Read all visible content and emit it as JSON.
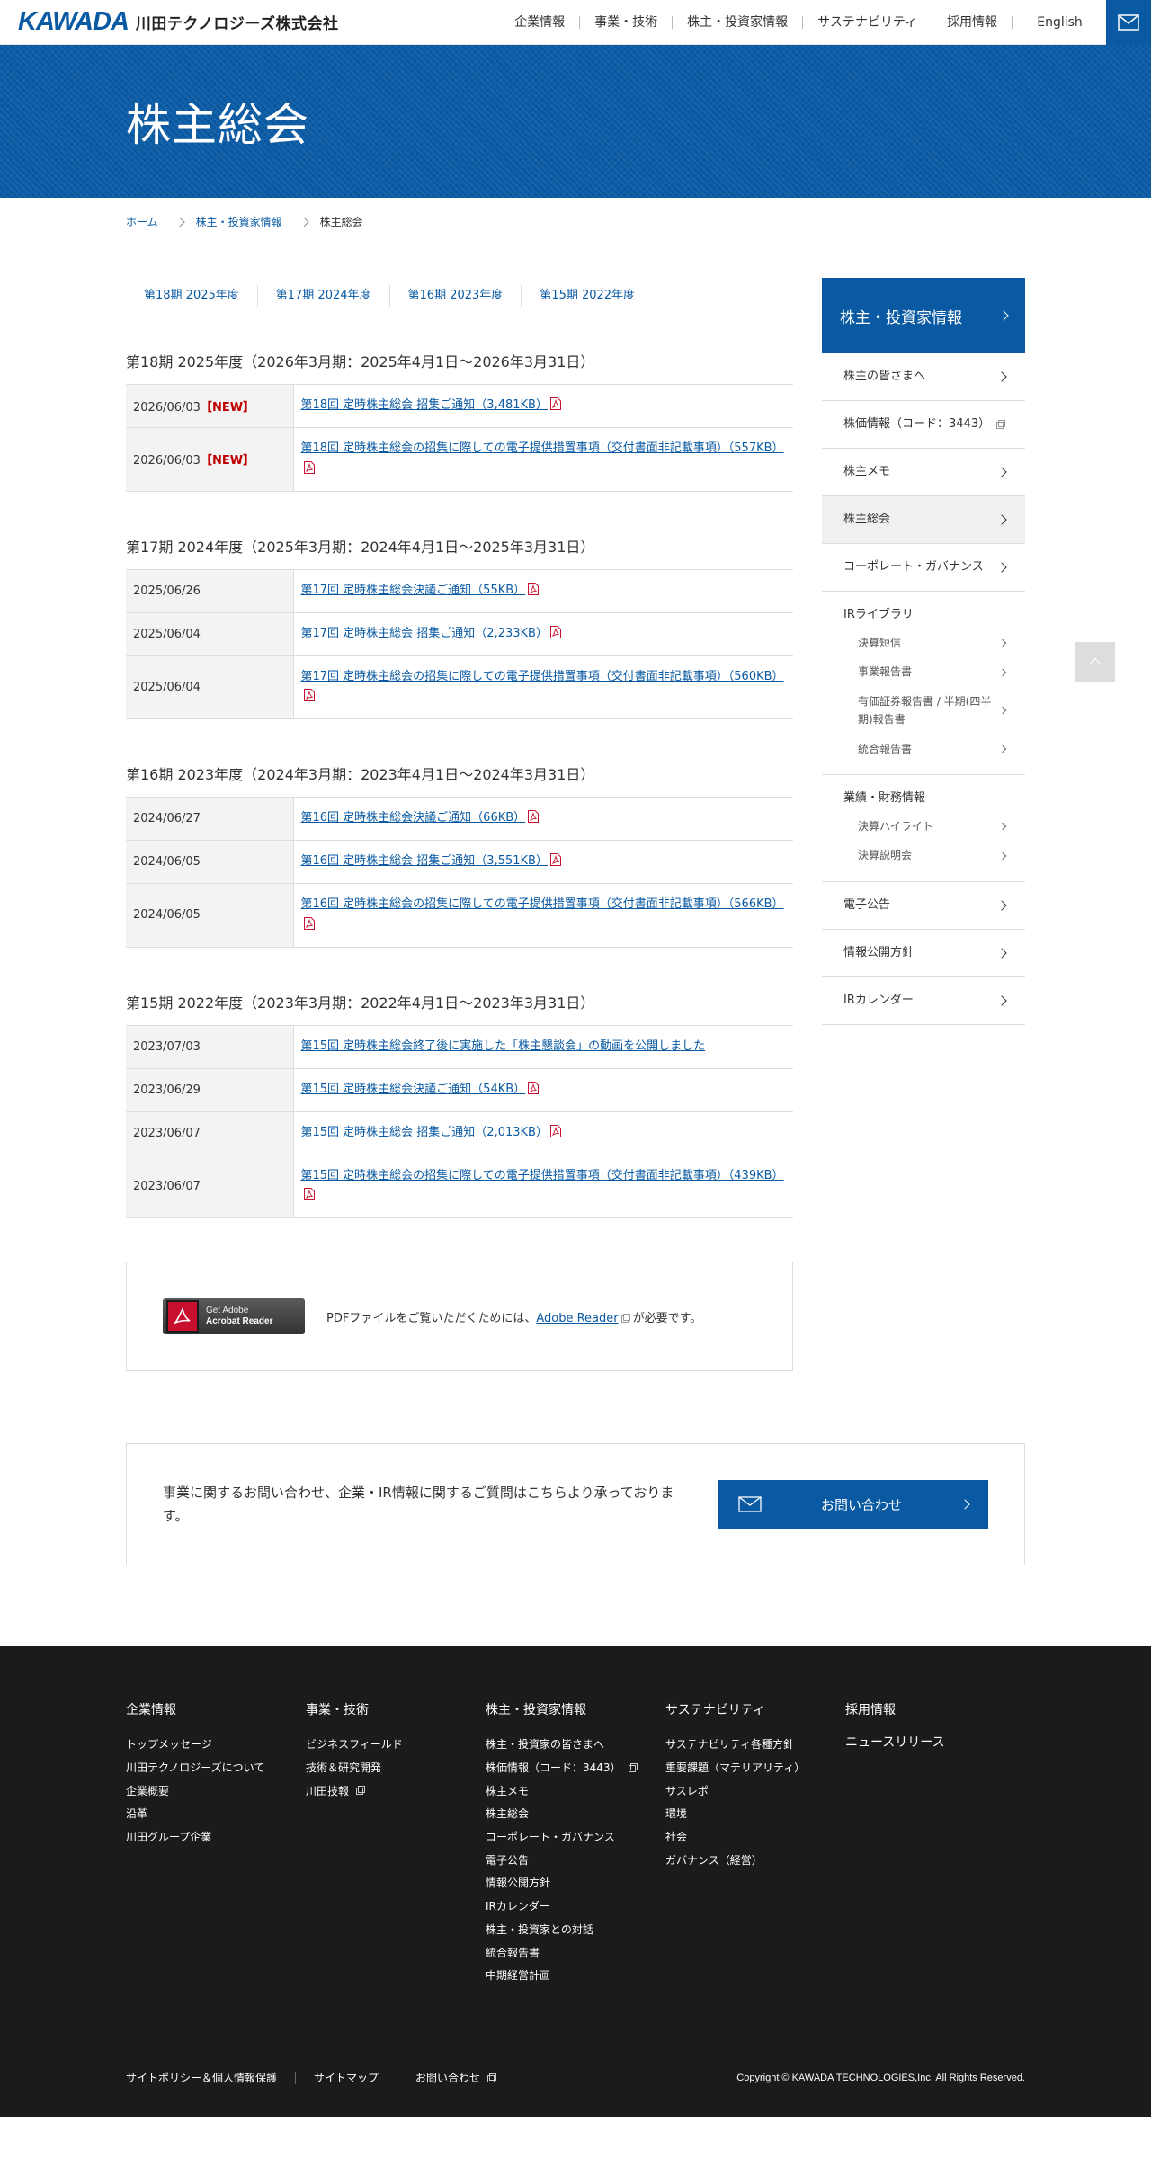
{
  "header": {
    "logo_mark": "KAWADA",
    "logo_name": "川田テクノロジーズ株式会社",
    "nav": [
      "企業情報",
      "事業・技術",
      "株主・投資家情報",
      "サステナビリティ",
      "採用情報"
    ],
    "lang": "English"
  },
  "hero": {
    "title": "株主総会"
  },
  "breadcrumb": {
    "home": "ホーム",
    "parent": "株主・投資家情報",
    "current": "株主総会"
  },
  "anchors": [
    "第18期 2025年度",
    "第17期 2024年度",
    "第16期 2023年度",
    "第15期 2022年度"
  ],
  "sections": [
    {
      "title": "第18期 2025年度（2026年3月期：2025年4月1日～2026年3月31日）",
      "rows": [
        {
          "date": "2026/06/03",
          "new": "【NEW】",
          "text": "第18回 定時株主総会 招集ご通知（3,481KB）",
          "pdf": true
        },
        {
          "date": "2026/06/03",
          "new": "【NEW】",
          "text": "第18回 定時株主総会の招集に際しての電子提供措置事項（交付書面非記載事項）（557KB）",
          "pdf": true
        }
      ]
    },
    {
      "title": "第17期 2024年度（2025年3月期：2024年4月1日～2025年3月31日）",
      "rows": [
        {
          "date": "2025/06/26",
          "new": "",
          "text": "第17回 定時株主総会決議ご通知（55KB）",
          "pdf": true
        },
        {
          "date": "2025/06/04",
          "new": "",
          "text": "第17回 定時株主総会 招集ご通知（2,233KB）",
          "pdf": true
        },
        {
          "date": "2025/06/04",
          "new": "",
          "text": "第17回 定時株主総会の招集に際しての電子提供措置事項（交付書面非記載事項）（560KB）",
          "pdf": true
        }
      ]
    },
    {
      "title": "第16期 2023年度（2024年3月期：2023年4月1日～2024年3月31日）",
      "rows": [
        {
          "date": "2024/06/27",
          "new": "",
          "text": "第16回 定時株主総会決議ご通知（66KB）",
          "pdf": true
        },
        {
          "date": "2024/06/05",
          "new": "",
          "text": "第16回 定時株主総会 招集ご通知（3,551KB）",
          "pdf": true
        },
        {
          "date": "2024/06/05",
          "new": "",
          "text": "第16回 定時株主総会の招集に際しての電子提供措置事項（交付書面非記載事項）（566KB）",
          "pdf": true
        }
      ]
    },
    {
      "title": "第15期 2022年度（2023年3月期：2022年4月1日～2023年3月31日）",
      "rows": [
        {
          "date": "2023/07/03",
          "new": "",
          "text": "第15回 定時株主総会終了後に実施した「株主懇談会」の動画を公開しました",
          "pdf": false
        },
        {
          "date": "2023/06/29",
          "new": "",
          "text": "第15回 定時株主総会決議ご通知（54KB）",
          "pdf": true
        },
        {
          "date": "2023/06/07",
          "new": "",
          "text": "第15回 定時株主総会 招集ご通知（2,013KB）",
          "pdf": true
        },
        {
          "date": "2023/06/07",
          "new": "",
          "text": "第15回 定時株主総会の招集に際しての電子提供措置事項（交付書面非記載事項）（439KB）",
          "pdf": true
        }
      ]
    }
  ],
  "adobe": {
    "badge_line1": "Get Adobe",
    "badge_line2": "Acrobat Reader",
    "text_before": "PDFファイルをご覧いただくためには、",
    "link": "Adobe Reader",
    "text_after": "が必要です。"
  },
  "sidebar": {
    "head": "株主・投資家情報",
    "items": [
      {
        "label": "株主の皆さまへ"
      },
      {
        "label": "株価情報（コード：3443）",
        "external": true
      },
      {
        "label": "株主メモ"
      },
      {
        "label": "株主総会",
        "active": true
      },
      {
        "label": "コーポレート・ガバナンス"
      }
    ],
    "ir_library": {
      "title": "IRライブラリ",
      "subs": [
        "決算短信",
        "事業報告書",
        "有価証券報告書 / 半期(四半期)報告書",
        "統合報告書"
      ]
    },
    "performance": {
      "title": "業績・財務情報",
      "subs": [
        "決算ハイライト",
        "決算説明会"
      ]
    },
    "items_after": [
      {
        "label": "電子公告"
      },
      {
        "label": "情報公開方針"
      },
      {
        "label": "IRカレンダー"
      }
    ]
  },
  "contact": {
    "text": "事業に関するお問い合わせ、企業・IR情報に関するご質問はこちらより承っております。",
    "button": "お問い合わせ"
  },
  "footer": {
    "columns": [
      {
        "head": "企業情報",
        "links": [
          {
            "t": "トップメッセージ"
          },
          {
            "t": "川田テクノロジーズについて"
          },
          {
            "t": "企業概要"
          },
          {
            "t": "沿革"
          },
          {
            "t": "川田グループ企業"
          }
        ]
      },
      {
        "head": "事業・技術",
        "links": [
          {
            "t": "ビジネスフィールド"
          },
          {
            "t": "技術＆研究開発"
          },
          {
            "t": "川田技報",
            "ext": true
          }
        ]
      },
      {
        "head": "株主・投資家情報",
        "links": [
          {
            "t": "株主・投資家の皆さまへ"
          },
          {
            "t": "株価情報（コード：3443）",
            "ext": true
          },
          {
            "t": "株主メモ"
          },
          {
            "t": "株主総会"
          },
          {
            "t": "コーポレート・ガバナンス"
          },
          {
            "t": "電子公告"
          },
          {
            "t": "情報公開方針"
          },
          {
            "t": "IRカレンダー"
          },
          {
            "t": "株主・投資家との対話"
          },
          {
            "t": "統合報告書"
          },
          {
            "t": "中期経営計画"
          }
        ]
      },
      {
        "head": "サステナビリティ",
        "links": [
          {
            "t": "サステナビリティ各種方針"
          },
          {
            "t": "重要課題（マテリアリティ）"
          },
          {
            "t": "サスレポ"
          },
          {
            "t": "環境"
          },
          {
            "t": "社会"
          },
          {
            "t": "ガバナンス（経営）"
          }
        ]
      },
      {
        "head": "採用情報",
        "extra_head": "ニュースリリース",
        "links": []
      }
    ],
    "bottom_links": [
      {
        "t": "サイトポリシー＆個人情報保護"
      },
      {
        "t": "サイトマップ"
      },
      {
        "t": "お問い合わせ",
        "ext": true
      }
    ],
    "copyright": "Copyright © KAWADA TECHNOLOGIES,Inc. All Rights Reserved."
  },
  "colors": {
    "brand": "#0a5aa3",
    "new": "#c00000",
    "footer_bg": "#1b1b1b"
  }
}
